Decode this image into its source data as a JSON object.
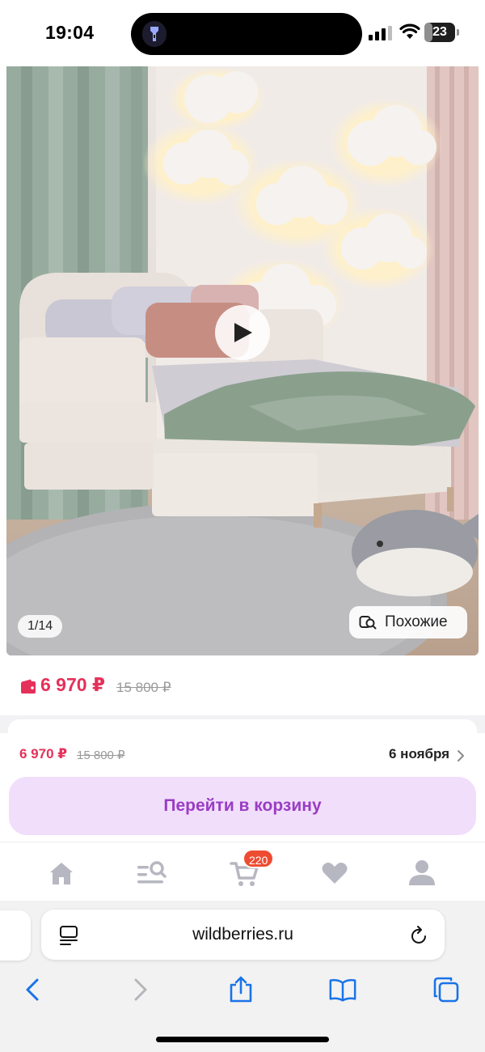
{
  "status_bar": {
    "time": "19:04",
    "battery_level": "23"
  },
  "product": {
    "photo_counter": "1/14",
    "similar_label": "Похожие",
    "price": "6 970 ₽",
    "old_price": "15 800 ₽"
  },
  "buy_panel": {
    "price": "6 970 ₽",
    "old_price": "15 800 ₽",
    "delivery_date": "6 ноября",
    "cart_button_label": "Перейти в корзину"
  },
  "tab_bar": {
    "cart_count": "220",
    "items": [
      "home",
      "catalog-search",
      "cart",
      "favorites",
      "profile"
    ]
  },
  "browser": {
    "url": "wildberries.ru"
  },
  "colors": {
    "price": "#e5305a",
    "cart_button_bg": "#f1defb",
    "cart_button_text": "#9a3cc4",
    "badge": "#ee4c32",
    "browser_accent": "#1a73e8"
  }
}
